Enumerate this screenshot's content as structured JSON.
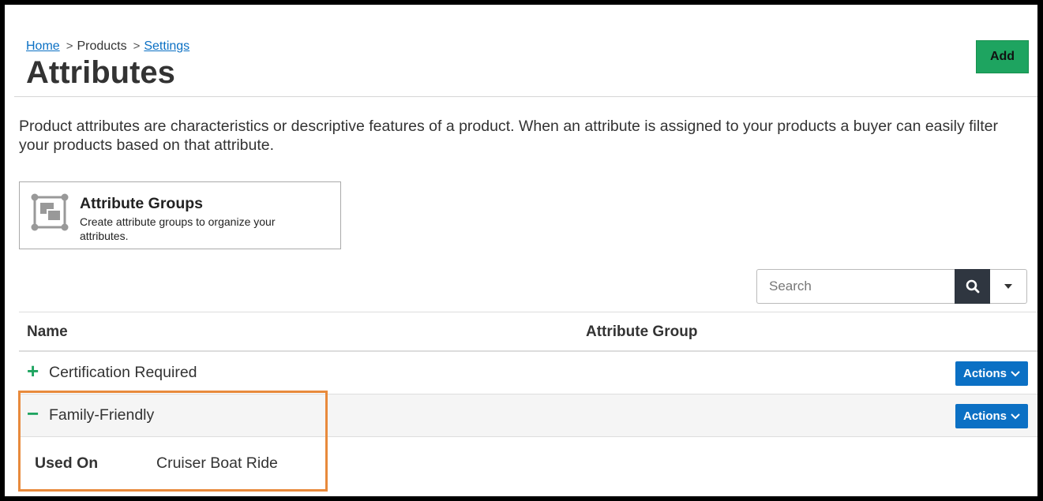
{
  "breadcrumb": {
    "home": "Home",
    "separator": ">",
    "products": "Products",
    "settings": "Settings"
  },
  "page": {
    "title": "Attributes",
    "add_label": "Add",
    "description": "Product attributes are characteristics or descriptive features of a product. When an attribute is assigned to your products a buyer can easily filter your products based on that attribute."
  },
  "attribute_groups_card": {
    "icon": "attribute-groups-icon",
    "title": "Attribute Groups",
    "description": "Create attribute groups to organize your attributes."
  },
  "search": {
    "placeholder": "Search",
    "value": ""
  },
  "table": {
    "headers": {
      "name": "Name",
      "group": "Attribute Group"
    },
    "rows": [
      {
        "toggle": "+",
        "name": "Certification Required",
        "group": "",
        "actions_label": "Actions",
        "expanded": false
      },
      {
        "toggle": "−",
        "name": "Family-Friendly",
        "group": "",
        "actions_label": "Actions",
        "expanded": true
      }
    ],
    "detail": {
      "label": "Used On",
      "value": "Cruiser Boat Ride"
    }
  },
  "colors": {
    "accent_green": "#1ea460",
    "action_blue": "#0b70c4",
    "highlight_orange": "#e88a3c",
    "search_btn": "#2f3640"
  }
}
